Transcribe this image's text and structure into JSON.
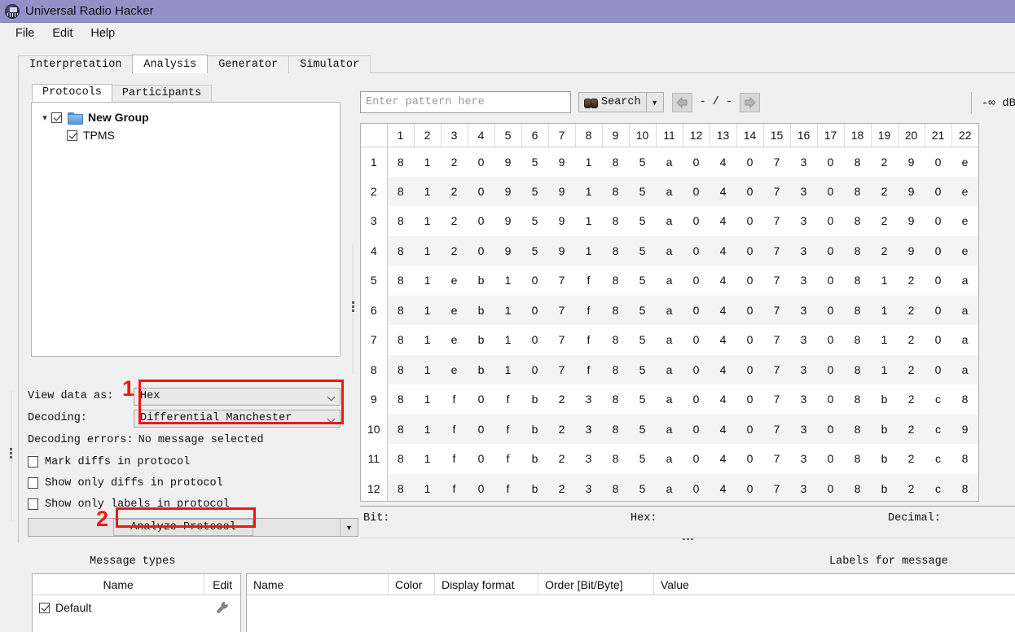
{
  "window": {
    "title": "Universal Radio Hacker",
    "icon": "urh-logo-icon",
    "titlebar_color": "#9491c8"
  },
  "menubar": {
    "items": [
      {
        "label": "File"
      },
      {
        "label": "Edit"
      },
      {
        "label": "Help"
      }
    ]
  },
  "main_tabs": {
    "items": [
      {
        "label": "Interpretation",
        "active": false
      },
      {
        "label": "Analysis",
        "active": true
      },
      {
        "label": "Generator",
        "active": false
      },
      {
        "label": "Simulator",
        "active": false
      }
    ]
  },
  "left_panel": {
    "sub_tabs": [
      {
        "label": "Protocols",
        "active": true
      },
      {
        "label": "Participants",
        "active": false
      }
    ],
    "tree": [
      {
        "label": "New Group",
        "checked": true,
        "expanded": true,
        "bold": true,
        "icon": "folder-icon",
        "chevron": "chevron-down-icon"
      },
      {
        "label": "TPMS",
        "checked": true,
        "bold": false,
        "child": true
      }
    ],
    "view_data_as": {
      "label": "View data as:",
      "value": "Hex"
    },
    "decoding": {
      "label": "Decoding:",
      "value": "Differential Manchester"
    },
    "decoding_errors": {
      "label": "Decoding errors:",
      "value": "No message selected"
    },
    "checkboxes": [
      {
        "label": "Mark diffs in protocol",
        "checked": false
      },
      {
        "label": "Show only diffs in protocol",
        "checked": false
      },
      {
        "label": "Show only labels in protocol",
        "checked": false
      }
    ],
    "analyze_button": {
      "label": "Analyze Protocol",
      "dropdown_icon": "triangle-down-icon"
    }
  },
  "annotations": [
    {
      "number": "1",
      "color": "#f11515"
    },
    {
      "number": "2",
      "color": "#f11515"
    }
  ],
  "search": {
    "placeholder": "Enter pattern here",
    "value": "",
    "button_label": "Search",
    "button_icon": "binoculars-icon",
    "dropdown_icon": "triangle-down-icon",
    "prev_icon": "arrow-left-icon",
    "next_icon": "arrow-right-icon",
    "counter": "- / -"
  },
  "db_readout": {
    "value": "-∞ dB"
  },
  "hex_table": {
    "columns": [
      "1",
      "2",
      "3",
      "4",
      "5",
      "6",
      "7",
      "8",
      "9",
      "10",
      "11",
      "12",
      "13",
      "14",
      "15",
      "16",
      "17",
      "18",
      "19",
      "20",
      "21",
      "22"
    ],
    "rows": [
      {
        "index": "1",
        "cells": [
          "8",
          "1",
          "2",
          "0",
          "9",
          "5",
          "9",
          "1",
          "8",
          "5",
          "a",
          "0",
          "4",
          "0",
          "7",
          "3",
          "0",
          "8",
          "2",
          "9",
          "0",
          "e"
        ]
      },
      {
        "index": "2",
        "cells": [
          "8",
          "1",
          "2",
          "0",
          "9",
          "5",
          "9",
          "1",
          "8",
          "5",
          "a",
          "0",
          "4",
          "0",
          "7",
          "3",
          "0",
          "8",
          "2",
          "9",
          "0",
          "e"
        ]
      },
      {
        "index": "3",
        "cells": [
          "8",
          "1",
          "2",
          "0",
          "9",
          "5",
          "9",
          "1",
          "8",
          "5",
          "a",
          "0",
          "4",
          "0",
          "7",
          "3",
          "0",
          "8",
          "2",
          "9",
          "0",
          "e"
        ]
      },
      {
        "index": "4",
        "cells": [
          "8",
          "1",
          "2",
          "0",
          "9",
          "5",
          "9",
          "1",
          "8",
          "5",
          "a",
          "0",
          "4",
          "0",
          "7",
          "3",
          "0",
          "8",
          "2",
          "9",
          "0",
          "e"
        ]
      },
      {
        "index": "5",
        "cells": [
          "8",
          "1",
          "e",
          "b",
          "1",
          "0",
          "7",
          "f",
          "8",
          "5",
          "a",
          "0",
          "4",
          "0",
          "7",
          "3",
          "0",
          "8",
          "1",
          "2",
          "0",
          "a"
        ]
      },
      {
        "index": "6",
        "cells": [
          "8",
          "1",
          "e",
          "b",
          "1",
          "0",
          "7",
          "f",
          "8",
          "5",
          "a",
          "0",
          "4",
          "0",
          "7",
          "3",
          "0",
          "8",
          "1",
          "2",
          "0",
          "a"
        ]
      },
      {
        "index": "7",
        "cells": [
          "8",
          "1",
          "e",
          "b",
          "1",
          "0",
          "7",
          "f",
          "8",
          "5",
          "a",
          "0",
          "4",
          "0",
          "7",
          "3",
          "0",
          "8",
          "1",
          "2",
          "0",
          "a"
        ]
      },
      {
        "index": "8",
        "cells": [
          "8",
          "1",
          "e",
          "b",
          "1",
          "0",
          "7",
          "f",
          "8",
          "5",
          "a",
          "0",
          "4",
          "0",
          "7",
          "3",
          "0",
          "8",
          "1",
          "2",
          "0",
          "a"
        ]
      },
      {
        "index": "9",
        "cells": [
          "8",
          "1",
          "f",
          "0",
          "f",
          "b",
          "2",
          "3",
          "8",
          "5",
          "a",
          "0",
          "4",
          "0",
          "7",
          "3",
          "0",
          "8",
          "b",
          "2",
          "c",
          "8"
        ]
      },
      {
        "index": "10",
        "cells": [
          "8",
          "1",
          "f",
          "0",
          "f",
          "b",
          "2",
          "3",
          "8",
          "5",
          "a",
          "0",
          "4",
          "0",
          "7",
          "3",
          "0",
          "8",
          "b",
          "2",
          "c",
          "9"
        ]
      },
      {
        "index": "11",
        "cells": [
          "8",
          "1",
          "f",
          "0",
          "f",
          "b",
          "2",
          "3",
          "8",
          "5",
          "a",
          "0",
          "4",
          "0",
          "7",
          "3",
          "0",
          "8",
          "b",
          "2",
          "c",
          "8"
        ]
      },
      {
        "index": "12",
        "cells": [
          "8",
          "1",
          "f",
          "0",
          "f",
          "b",
          "2",
          "3",
          "8",
          "5",
          "a",
          "0",
          "4",
          "0",
          "7",
          "3",
          "0",
          "8",
          "b",
          "2",
          "c",
          "8"
        ]
      }
    ]
  },
  "status_readouts": {
    "bit_label": "Bit:",
    "hex_label": "Hex:",
    "decimal_label": "Decimal:"
  },
  "bottom": {
    "message_types_title": "Message types",
    "labels_title": "Labels for message",
    "message_types_columns": [
      "Name",
      "Edit"
    ],
    "message_types_rows": [
      {
        "name": "Default",
        "checked": true,
        "edit_icon": "wrench-icon"
      }
    ],
    "labels_columns": [
      "Name",
      "Color",
      "Display format",
      "Order [Bit/Byte]",
      "Value"
    ],
    "labels_rows": []
  }
}
